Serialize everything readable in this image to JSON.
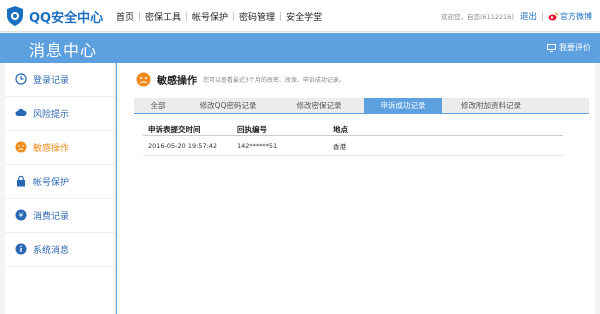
{
  "header": {
    "logo_text": "QQ安全中心",
    "nav": [
      "首页",
      "密保工具",
      "帐号保护",
      "密码管理",
      "安全学堂"
    ],
    "welcome": "欢迎您，自恋(6112216)",
    "logout": "退出",
    "weibo": "官方微博"
  },
  "banner": {
    "title": "消息中心",
    "feedback": "我要评价"
  },
  "sidebar": {
    "items": [
      {
        "label": "登录记录",
        "icon": "clock-icon"
      },
      {
        "label": "风险提示",
        "icon": "cloud-icon"
      },
      {
        "label": "敏感操作",
        "icon": "sad-face-icon"
      },
      {
        "label": "帐号保护",
        "icon": "lock-icon"
      },
      {
        "label": "消费记录",
        "icon": "coin-icon"
      },
      {
        "label": "系统消息",
        "icon": "info-icon"
      }
    ],
    "active_index": 2
  },
  "main": {
    "title": "敏感操作",
    "subtitle": "您可以查看最近3个月的改密、改保、申诉成功记录。",
    "tabs": [
      "全部",
      "修改QQ密码记录",
      "修改密保记录",
      "申诉成功记录",
      "修改附加资料记录"
    ],
    "active_tab": 3,
    "table": {
      "headers": [
        "申诉表提交时间",
        "回执编号",
        "地点"
      ],
      "rows": [
        [
          "2016-05-20 19:57:42",
          "142******51",
          "香港"
        ]
      ]
    }
  },
  "colors": {
    "accent": "#5da0e0",
    "link": "#2a67b4",
    "active": "#f08c1e"
  }
}
